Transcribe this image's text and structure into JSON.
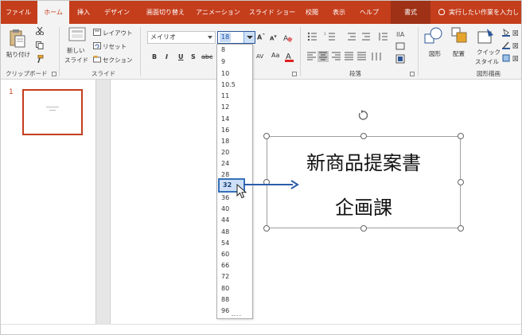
{
  "ribbon": {
    "tabs": [
      {
        "id": "file",
        "label": "ファイル"
      },
      {
        "id": "home",
        "label": "ホーム"
      },
      {
        "id": "insert",
        "label": "挿入"
      },
      {
        "id": "design",
        "label": "デザイン"
      },
      {
        "id": "transitions",
        "label": "画面切り替え"
      },
      {
        "id": "animations",
        "label": "アニメーション"
      },
      {
        "id": "slideshow",
        "label": "スライド ショー"
      },
      {
        "id": "review",
        "label": "校閲"
      },
      {
        "id": "view",
        "label": "表示"
      },
      {
        "id": "help",
        "label": "ヘルプ"
      },
      {
        "id": "format",
        "label": "書式"
      }
    ],
    "tell_me": "実行したい作業を入力し",
    "groups": {
      "clipboard": {
        "label": "クリップボード",
        "paste": "貼り付け"
      },
      "slides": {
        "label": "スライド",
        "new_slide_1": "新しい",
        "new_slide_2": "スライド",
        "layout": "レイアウト",
        "reset": "リセット",
        "section": "セクション"
      },
      "font": {
        "label": "フォ",
        "font_name": "メイリオ",
        "font_size": "18",
        "bold": "B",
        "italic": "I",
        "underline": "U",
        "strike": "S",
        "abc": "abc",
        "av": "AV",
        "aa": "Aa"
      },
      "paragraph": {
        "label": "段落"
      },
      "drawing": {
        "label": "図形描画",
        "shapes": "図形",
        "arrange": "配置",
        "quick_styles_1": "クイック",
        "quick_styles_2": "スタイル",
        "fill": "図",
        "outline": "図",
        "effects": "図"
      }
    },
    "colors": {
      "accent": "#c43e1c",
      "format_tab": "#9e3116",
      "ribbon_bg": "#f3f3f3",
      "selection": "#3670b8"
    }
  },
  "font_size_dropdown": {
    "options": [
      "8",
      "9",
      "10",
      "10.5",
      "11",
      "12",
      "14",
      "16",
      "18",
      "20",
      "24",
      "28",
      "32",
      "36",
      "40",
      "44",
      "48",
      "54",
      "60",
      "66",
      "72",
      "80",
      "88",
      "96"
    ],
    "highlighted": "32"
  },
  "slides_pane": {
    "slide_number": "1"
  },
  "slide": {
    "line1": "新商品提案書",
    "line2": "企画課"
  }
}
